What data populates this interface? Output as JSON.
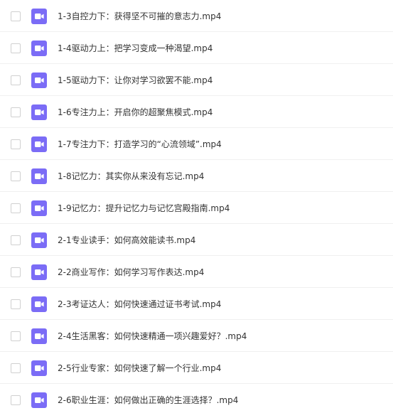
{
  "file_list": {
    "icon": "video-file-icon",
    "icon_color": "#7b6cf6",
    "items": [
      {
        "name": "1-3自控力下：获得坚不可摧的意志力.mp4"
      },
      {
        "name": "1-4驱动力上：把学习变成一种渴望.mp4"
      },
      {
        "name": "1-5驱动力下：让你对学习欲罢不能.mp4"
      },
      {
        "name": "1-6专注力上：开启你的超聚焦模式.mp4"
      },
      {
        "name": "1-7专注力下：打造学习的“心流领域”.mp4"
      },
      {
        "name": "1-8记忆力：其实你从来没有忘记.mp4"
      },
      {
        "name": "1-9记忆力：提升记忆力与记忆宫殿指南.mp4"
      },
      {
        "name": "2-1专业读手：如何高效能读书.mp4"
      },
      {
        "name": "2-2商业写作：如何学习写作表达.mp4"
      },
      {
        "name": "2-3考证达人：如何快速通过证书考试.mp4"
      },
      {
        "name": "2-4生活黑客：如何快速精通一项兴趣爱好？.mp4"
      },
      {
        "name": "2-5行业专家：如何快速了解一个行业.mp4"
      },
      {
        "name": "2-6职业生涯：如何做出正确的生涯选择？.mp4"
      }
    ]
  }
}
